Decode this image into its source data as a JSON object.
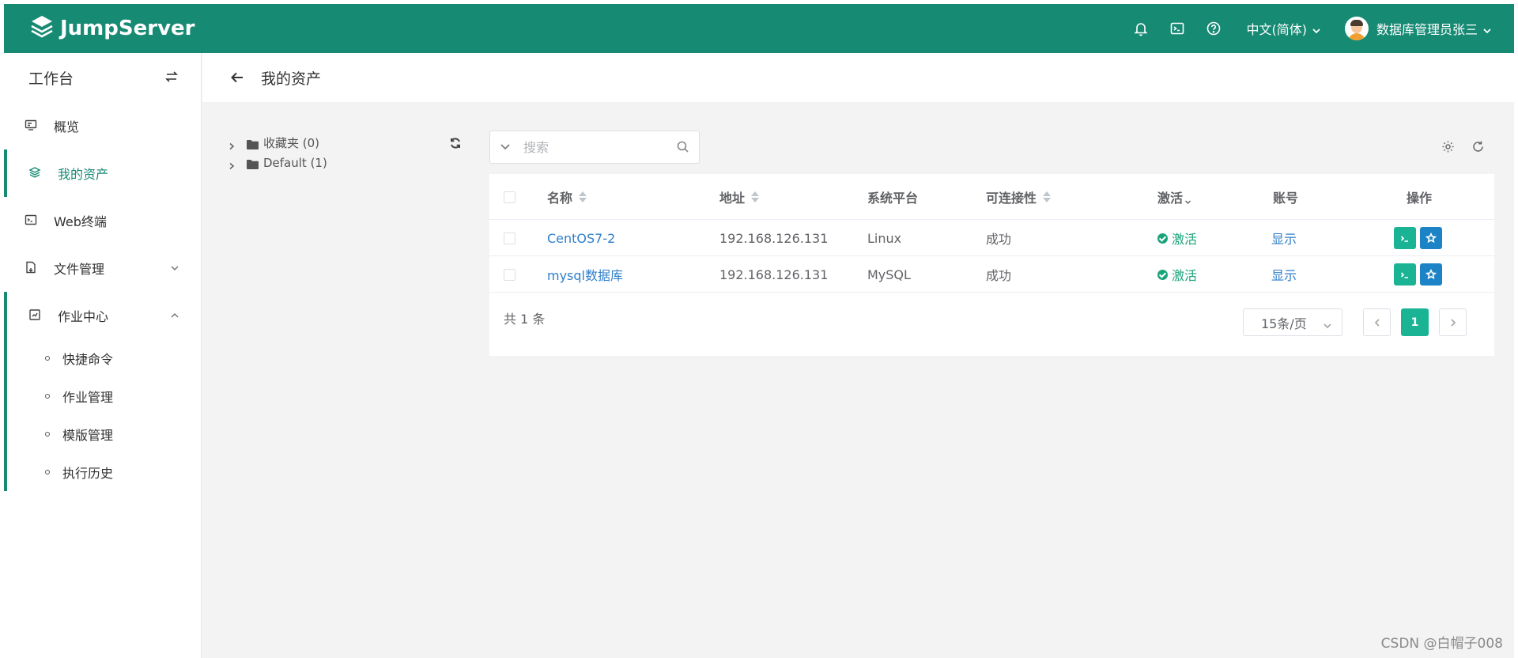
{
  "header": {
    "brand": "JumpServer",
    "language": "中文(简体)",
    "user_name": "数据库管理员张三"
  },
  "sidebar": {
    "title": "工作台",
    "items": [
      {
        "label": "概览"
      },
      {
        "label": "我的资产"
      },
      {
        "label": "Web终端"
      },
      {
        "label": "文件管理"
      },
      {
        "label": "作业中心"
      }
    ],
    "sub_items": [
      {
        "label": "快捷命令"
      },
      {
        "label": "作业管理"
      },
      {
        "label": "模版管理"
      },
      {
        "label": "执行历史"
      }
    ]
  },
  "page": {
    "title": "我的资产"
  },
  "tree": {
    "nodes": [
      {
        "label": "收藏夹 (0)"
      },
      {
        "label": "Default (1)"
      }
    ]
  },
  "search": {
    "placeholder": "搜索"
  },
  "table": {
    "columns": {
      "name": "名称",
      "address": "地址",
      "platform": "系统平台",
      "connectivity": "可连接性",
      "active": "激活",
      "account": "账号",
      "actions": "操作"
    },
    "rows": [
      {
        "name": "CentOS7-2",
        "address": "192.168.126.131",
        "platform": "Linux",
        "connectivity": "成功",
        "active": "激活",
        "account": "显示"
      },
      {
        "name": "mysql数据库",
        "address": "192.168.126.131",
        "platform": "MySQL",
        "connectivity": "成功",
        "active": "激活",
        "account": "显示"
      }
    ]
  },
  "pagination": {
    "total": "共 1 条",
    "page_size": "15条/页",
    "current_page": "1"
  },
  "watermark": "CSDN @白帽子008",
  "colors": {
    "primary": "#178a74",
    "success": "#1ab394",
    "link": "#2f7fc9",
    "favorite": "#1c84c6"
  }
}
